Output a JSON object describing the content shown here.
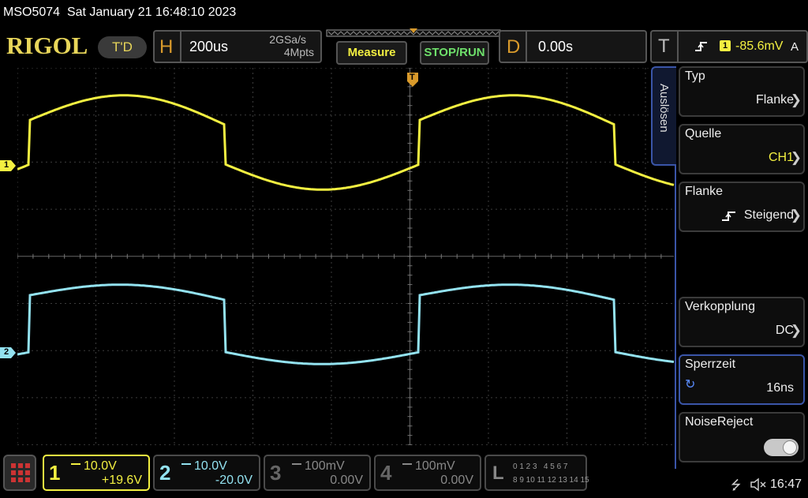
{
  "titlebar": {
    "model": "MSO5074",
    "datetime": "Sat January 21 16:48:10 2023"
  },
  "brand": {
    "logo": "RIGOL",
    "mode": "T'D"
  },
  "horizontal": {
    "letter": "H",
    "timebase": "200us",
    "sample_rate": "2GSa/s",
    "memory_depth": "4Mpts"
  },
  "toolbar": {
    "measure_label": "Measure",
    "stoprun_label": "STOP/RUN"
  },
  "delay": {
    "letter": "D",
    "value": "0.00s"
  },
  "trigger": {
    "letter": "T",
    "source_num": "1",
    "level": "-85.6mV",
    "mode": "A"
  },
  "side_menu": {
    "tab_label": "Auslösen",
    "items": [
      {
        "label": "Typ",
        "value": "Flanke"
      },
      {
        "label": "Quelle",
        "value": "CH1"
      },
      {
        "label": "Flanke",
        "value": "Steigend"
      },
      {
        "label": "Verkopplung",
        "value": "DC"
      },
      {
        "label": "Sperrzeit",
        "value": "16ns"
      },
      {
        "label": "NoiseReject",
        "value": ""
      }
    ]
  },
  "markers": {
    "ch1": "1",
    "ch2": "2",
    "trigger": "T"
  },
  "channels": [
    {
      "num": "1",
      "vdiv": "10.0V",
      "offset": "+19.6V",
      "color": "#f3f041"
    },
    {
      "num": "2",
      "vdiv": "10.0V",
      "offset": "-20.0V",
      "color": "#93e2f0"
    },
    {
      "num": "3",
      "vdiv": "100mV",
      "offset": "0.00V",
      "color": "#666666"
    },
    {
      "num": "4",
      "vdiv": "100mV",
      "offset": "0.00V",
      "color": "#666666"
    }
  ],
  "logic": {
    "letter": "L",
    "row1": "0 1 2 3   4 5 6 7",
    "row2": "8 9 10 11 12 13 14 15"
  },
  "status": {
    "time": "16:47"
  },
  "colors": {
    "ch1": "#f3f041",
    "ch2": "#93e2f0",
    "accent": "#d99a2b",
    "menu_border": "#3a55a8"
  }
}
